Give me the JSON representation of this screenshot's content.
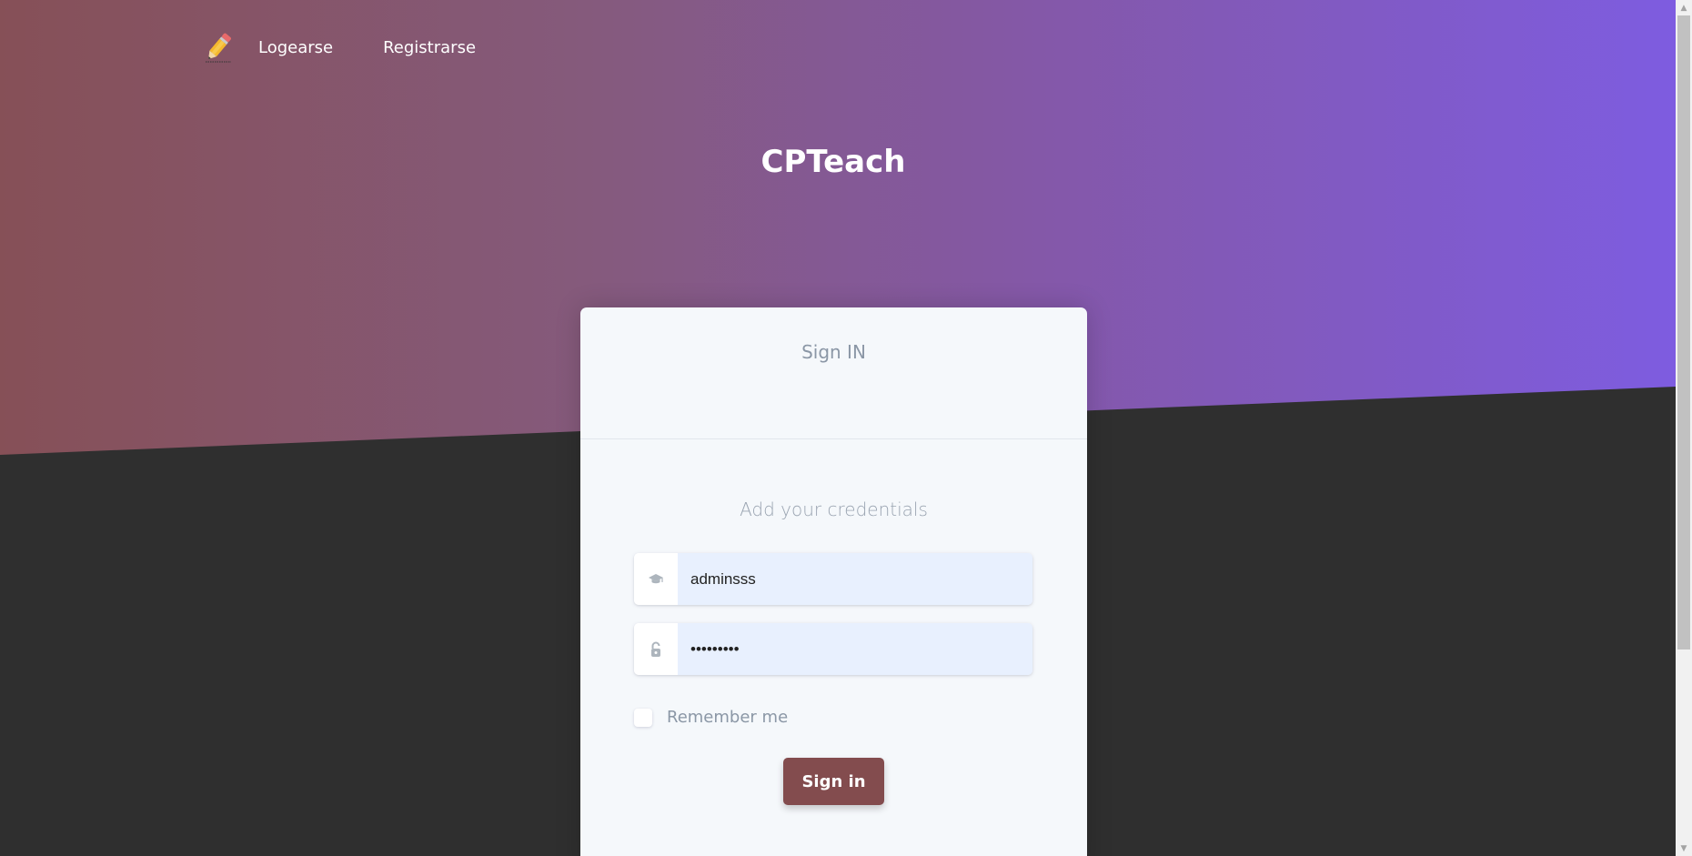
{
  "app": {
    "title": "CPTeach"
  },
  "nav": {
    "items": [
      {
        "label": "Logearse"
      },
      {
        "label": "Registrarse"
      }
    ]
  },
  "card": {
    "header": "Sign IN",
    "subtitle": "Add your credentials",
    "username": {
      "value": "adminsss",
      "icon": "graduation-cap-icon"
    },
    "password": {
      "value": "•••••••••",
      "icon": "unlock-icon"
    },
    "remember_label": "Remember me",
    "submit_label": "Sign in"
  },
  "colors": {
    "hero_gradient": [
      "#865057",
      "#855a7c",
      "#8458a8",
      "#7e5ce0"
    ],
    "page_background": "#2f2f2f",
    "card_background": "#f5f8fb",
    "button": "#834c4e"
  }
}
